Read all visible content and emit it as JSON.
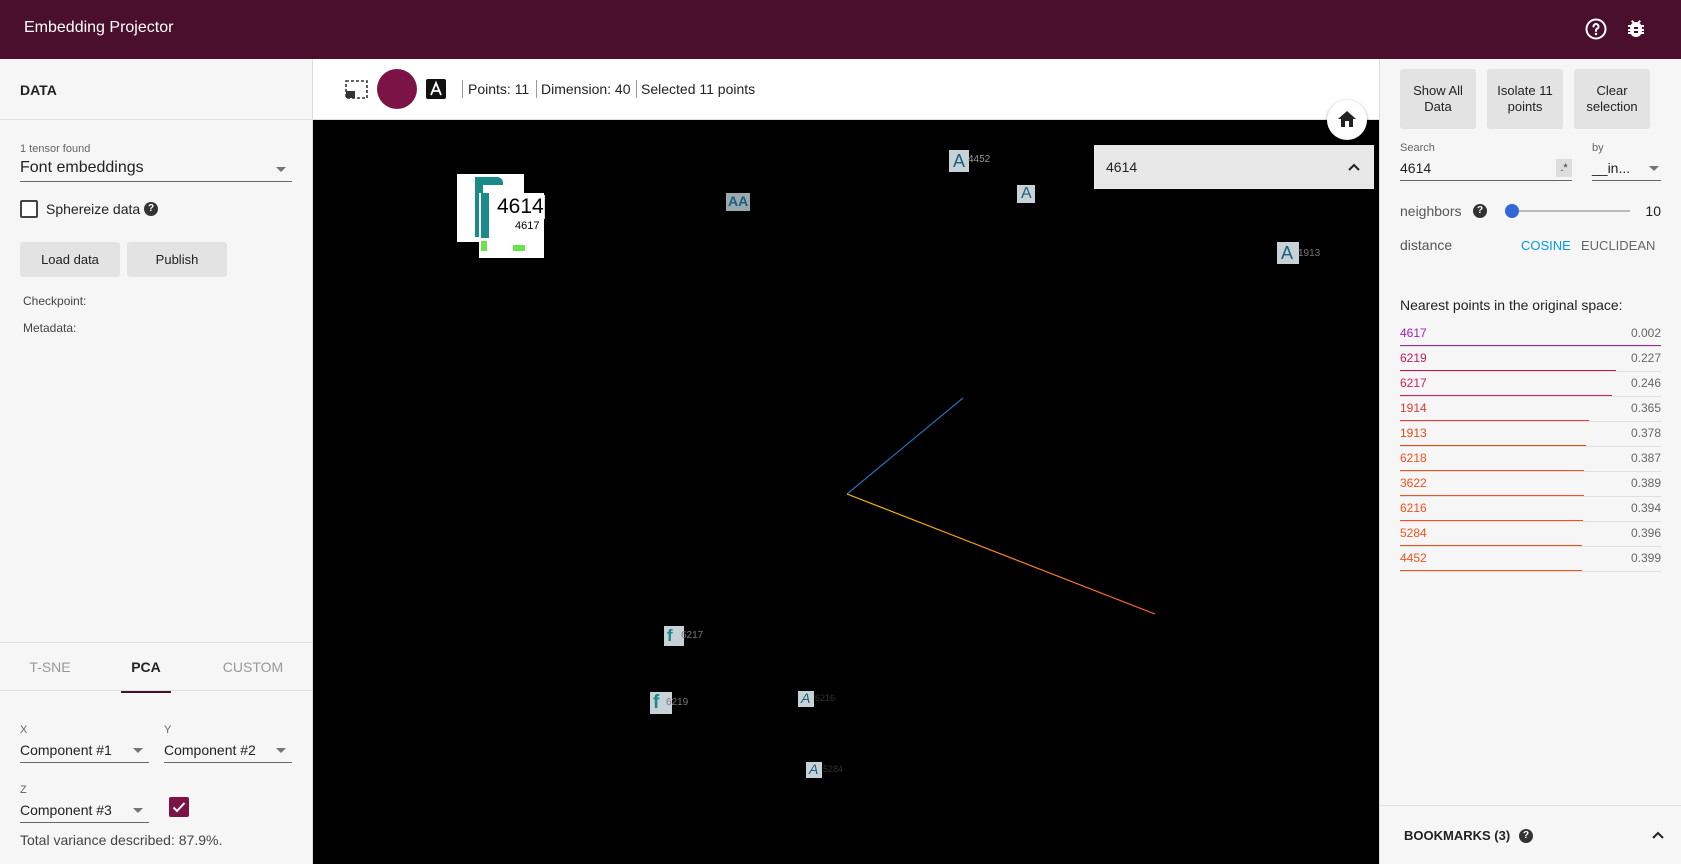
{
  "app": {
    "title": "Embedding Projector"
  },
  "data_panel": {
    "title": "DATA",
    "tensor_caption": "1 tensor found",
    "tensor_value": "Font embeddings",
    "sphereize_label": "Sphereize data",
    "load_label": "Load data",
    "publish_label": "Publish",
    "checkpoint_label": "Checkpoint:",
    "metadata_label": "Metadata:"
  },
  "projection": {
    "tabs": [
      {
        "label": "T-SNE",
        "active": false
      },
      {
        "label": "PCA",
        "active": true
      },
      {
        "label": "CUSTOM",
        "active": false
      }
    ],
    "x_caption": "X",
    "x_value": "Component #1",
    "y_caption": "Y",
    "y_value": "Component #2",
    "z_caption": "Z",
    "z_value": "Component #3",
    "z_checked": true,
    "variance_text": "Total variance described: 87.9%."
  },
  "toolbar": {
    "points": "Points: 11",
    "dimension": "Dimension: 40",
    "selected": "Selected 11 points"
  },
  "canvas": {
    "search_value": "4614",
    "primary_label": "4614",
    "secondary_label": "4617",
    "point_labels": [
      "4452",
      "1913",
      "6217",
      "6219",
      "6216",
      "5284"
    ]
  },
  "inspector": {
    "show_all": "Show All Data",
    "isolate": "Isolate 11 points",
    "clear": "Clear selection",
    "search_caption": "Search",
    "search_value": "4614",
    "regex_label": ".*",
    "by_caption": "by",
    "by_value": "__in...",
    "neighbors_label": "neighbors",
    "neighbors_value": "10",
    "slider_fraction": 0.0,
    "distance_label": "distance",
    "cosine_label": "COSINE",
    "euclidean_label": "EUCLIDEAN",
    "nearest_title": "Nearest points in the original space:",
    "neighbors": [
      {
        "id": "4617",
        "distance": "0.002",
        "color": "#9c27b0"
      },
      {
        "id": "6219",
        "distance": "0.227",
        "color": "#c2185b"
      },
      {
        "id": "6217",
        "distance": "0.246",
        "color": "#d81b60"
      },
      {
        "id": "1914",
        "distance": "0.365",
        "color": "#e53935"
      },
      {
        "id": "1913",
        "distance": "0.378",
        "color": "#e64a19"
      },
      {
        "id": "6218",
        "distance": "0.387",
        "color": "#f4511e"
      },
      {
        "id": "3622",
        "distance": "0.389",
        "color": "#f4511e"
      },
      {
        "id": "6216",
        "distance": "0.394",
        "color": "#f4511e"
      },
      {
        "id": "5284",
        "distance": "0.396",
        "color": "#f4511e"
      },
      {
        "id": "4452",
        "distance": "0.399",
        "color": "#f4511e"
      }
    ],
    "bookmarks_label": "BOOKMARKS (3)"
  },
  "colors": {
    "brand": "#4b0f2e",
    "accent_blue": "#039be5",
    "slider_blue": "#3367d6"
  }
}
